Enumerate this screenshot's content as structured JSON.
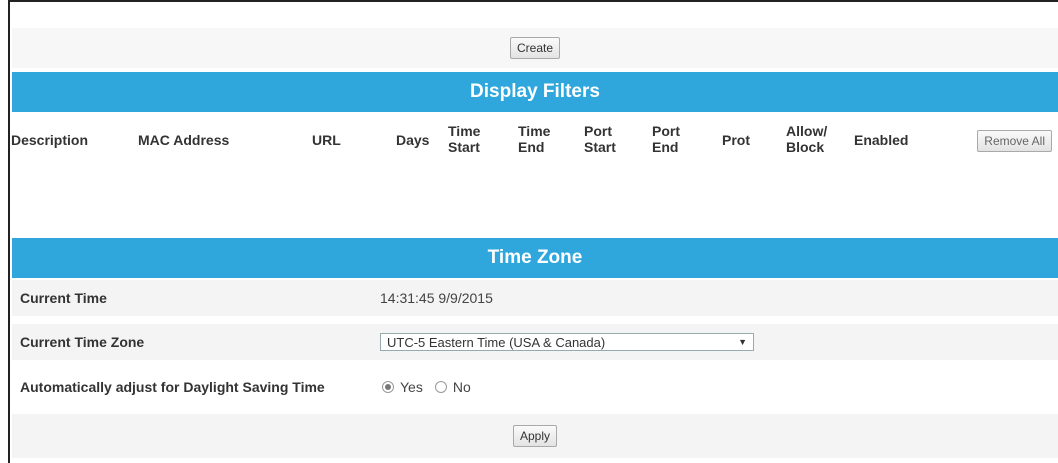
{
  "create_button": "Create",
  "display_filters": {
    "title": "Display Filters",
    "columns": [
      "Description",
      "MAC Address",
      "URL",
      "Days",
      "Time\nStart",
      "Time\nEnd",
      "Port\nStart",
      "Port\nEnd",
      "Prot",
      "Allow/\nBlock",
      "Enabled"
    ],
    "remove_all_button": "Remove All"
  },
  "time_zone": {
    "title": "Time Zone",
    "current_time_label": "Current Time",
    "current_time_value": "14:31:45 9/9/2015",
    "current_zone_label": "Current Time Zone",
    "current_zone_value": "UTC-5  Eastern Time (USA & Canada)",
    "dst_label": "Automatically adjust for Daylight Saving Time",
    "dst_yes": "Yes",
    "dst_no": "No",
    "dst_selected": "Yes",
    "apply_button": "Apply"
  }
}
